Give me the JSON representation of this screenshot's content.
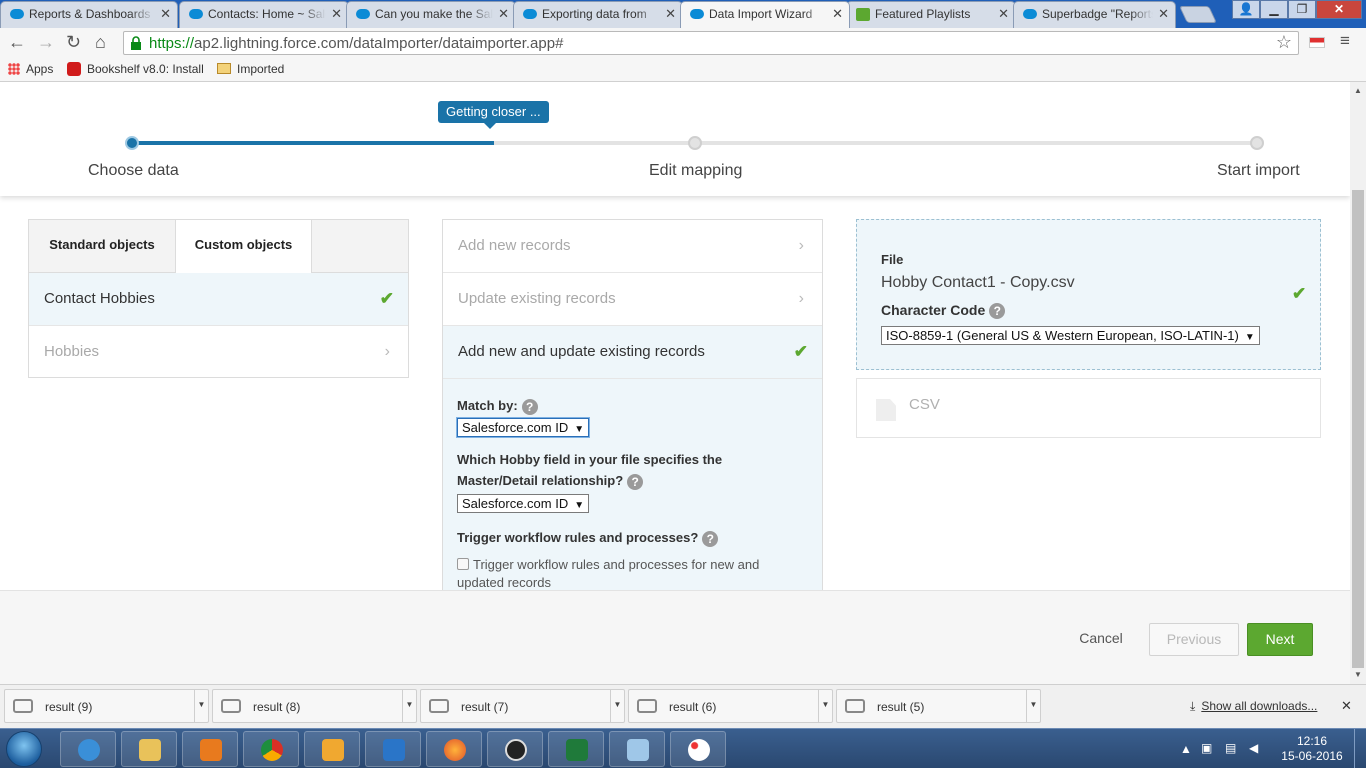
{
  "browser": {
    "tabs": [
      {
        "label": "Reports & Dashboards",
        "icon": "salesforce-icon",
        "active": false
      },
      {
        "label": "Contacts: Home ~ Salesforce",
        "icon": "salesforce-icon",
        "active": false
      },
      {
        "label": "Can you make the Salesforce",
        "icon": "salesforce-icon",
        "active": false
      },
      {
        "label": "Exporting data from",
        "icon": "salesforce-icon",
        "active": false
      },
      {
        "label": "Data Import Wizard",
        "icon": "salesforce-icon",
        "active": true
      },
      {
        "label": "Featured Playlists",
        "icon": "playlist-icon",
        "active": false
      },
      {
        "label": "Superbadge \"Reports",
        "icon": "salesforce-icon",
        "active": false
      }
    ],
    "url_scheme": "https://",
    "url_rest": "ap2.lightning.force.com/dataImporter/dataimporter.app#",
    "bookmarks": [
      "Apps",
      "Bookshelf v8.0: Install",
      "Imported"
    ]
  },
  "wizard": {
    "badge": "Getting closer ...",
    "progress_fraction": 0.321,
    "steps": [
      "Choose data",
      "Edit mapping",
      "Start import"
    ]
  },
  "objects_panel": {
    "tabs": [
      "Standard objects",
      "Custom objects"
    ],
    "selected_tab": "Custom objects",
    "items": [
      {
        "label": "Contact Hobbies",
        "selected": true
      },
      {
        "label": "Hobbies",
        "selected": false
      }
    ]
  },
  "action_panel": {
    "options": [
      {
        "label": "Add new records",
        "selected": false
      },
      {
        "label": "Update existing records",
        "selected": false
      },
      {
        "label": "Add new and update existing records",
        "selected": true
      }
    ],
    "match_by_label": "Match by:",
    "match_by_value": "Salesforce.com ID",
    "master_detail_label": "Which Hobby field in your file specifies the Master/Detail relationship?",
    "master_detail_value": "Salesforce.com ID",
    "trigger_label": "Trigger workflow rules and processes?",
    "trigger_checkbox_label": "Trigger workflow rules and processes for new and updated records",
    "trigger_checked": false
  },
  "file_panel": {
    "file_label": "File",
    "file_name": "Hobby Contact1 - Copy.csv",
    "char_code_label": "Character Code",
    "char_code_value": "ISO-8859-1 (General US & Western European, ISO-LATIN-1)",
    "csv_label": "CSV"
  },
  "footer": {
    "cancel": "Cancel",
    "previous": "Previous",
    "next": "Next"
  },
  "downloads": {
    "items": [
      "result (9)",
      "result (8)",
      "result (7)",
      "result (6)",
      "result (5)"
    ],
    "show_all": "Show all downloads..."
  },
  "taskbar": {
    "time": "12:16",
    "date": "15-06-2016"
  },
  "colors": {
    "accent_blue": "#1a73a8",
    "success_green": "#5ca830",
    "selected_row": "#eef6fa"
  }
}
